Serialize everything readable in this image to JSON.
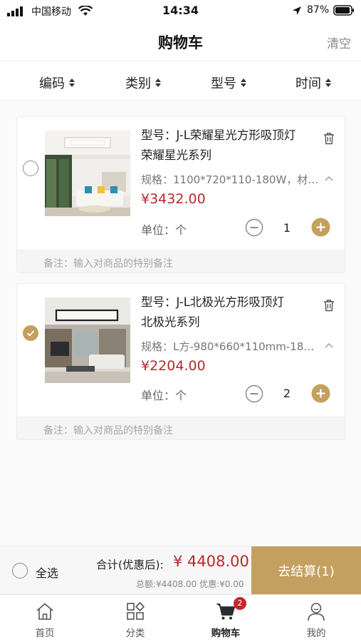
{
  "status_bar": {
    "carrier": "中国移动",
    "time": "14:34",
    "battery": "87%"
  },
  "nav": {
    "title": "购物车",
    "clear_label": "清空"
  },
  "sort": {
    "items": [
      {
        "label": "编码"
      },
      {
        "label": "类别"
      },
      {
        "label": "型号"
      },
      {
        "label": "时间"
      }
    ]
  },
  "cart": {
    "remark_placeholder": "备注：输入对商品的特别备注",
    "items": [
      {
        "name_line1": "型号：J-L荣耀星光方形吸顶灯",
        "name_line2": "荣耀星光系列",
        "spec": "规格：1100*720*110-180W，材…",
        "price": "¥3432.00",
        "unit": "单位：个",
        "quantity": "1",
        "selected": false
      },
      {
        "name_line1": "型号：J-L北极光方形吸顶灯",
        "name_line2": "北极光系列",
        "spec": "规格：L方-980*660*110mm-18…",
        "price": "¥2204.00",
        "unit": "单位：个",
        "quantity": "2",
        "selected": true
      }
    ]
  },
  "checkout": {
    "select_all_label": "全选",
    "total_label": "合计(优惠后):",
    "total_value": "¥ 4408.00",
    "summary": "总额:¥4408.00 优惠:¥0.00",
    "checkout_label": "去结算(1)"
  },
  "tabbar": {
    "items": [
      {
        "label": "首页",
        "icon": "home-icon"
      },
      {
        "label": "分类",
        "icon": "category-icon"
      },
      {
        "label": "购物车",
        "icon": "cart-icon",
        "badge": "2"
      },
      {
        "label": "我的",
        "icon": "profile-icon"
      }
    ]
  },
  "colors": {
    "accent": "#c4a060",
    "price": "#b8282e",
    "badge": "#c8262d"
  }
}
